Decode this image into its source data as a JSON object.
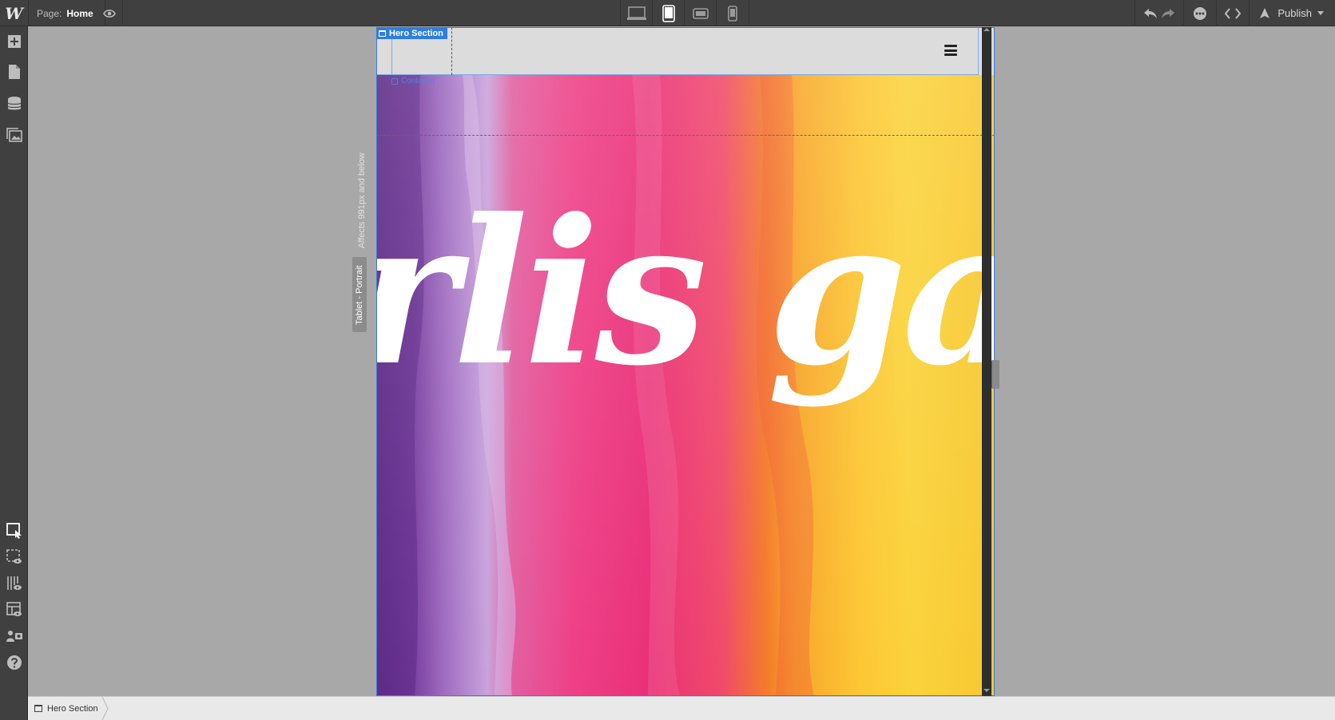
{
  "topbar": {
    "logo": "W",
    "page_label": "Page:",
    "page_name": "Home",
    "devices": [
      {
        "name": "desktop",
        "active": false
      },
      {
        "name": "tablet",
        "active": true
      },
      {
        "name": "mobile-landscape",
        "active": false
      },
      {
        "name": "mobile-portrait",
        "active": false
      }
    ],
    "publish_label": "Publish"
  },
  "canvas": {
    "hero_tag": "Hero Section",
    "container_tag": "Container",
    "hero_script_text": "rlis gar",
    "breakpoint_label": "Tablet - Portrait",
    "breakpoint_note": "Affects 991px and below",
    "colors": {
      "selection": "#2d7ee0",
      "hero_purple": "#7a3fa0",
      "hero_pink": "#ee3f86",
      "hero_orange": "#f47a2a",
      "hero_yellow": "#fcc634"
    }
  },
  "breadcrumb": {
    "items": [
      "Hero Section"
    ]
  }
}
